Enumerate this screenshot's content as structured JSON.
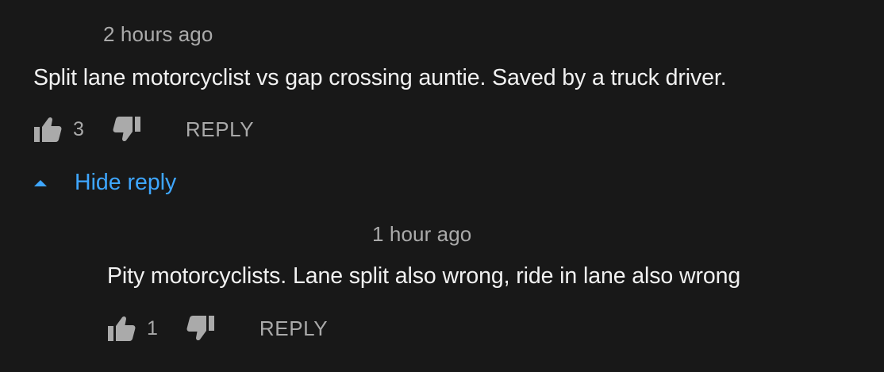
{
  "thread": {
    "comment": {
      "timestamp": "2 hours ago",
      "text": "Split lane motorcyclist vs gap crossing auntie. Saved by a truck driver.",
      "like_count": "3",
      "reply_label": "REPLY"
    },
    "toggle": {
      "label": "Hide reply",
      "icon": "caret-up-icon"
    },
    "reply": {
      "timestamp": "1 hour ago",
      "text": "Pity motorcyclists. Lane split also wrong, ride in lane also wrong",
      "like_count": "1",
      "reply_label": "REPLY"
    }
  },
  "icons": {
    "like": "thumbs-up-icon",
    "dislike": "thumbs-down-icon"
  },
  "colors": {
    "background": "#181818",
    "text_primary": "#f1f1f1",
    "text_secondary": "#aaaaaa",
    "link_blue": "#3ea6ff"
  }
}
